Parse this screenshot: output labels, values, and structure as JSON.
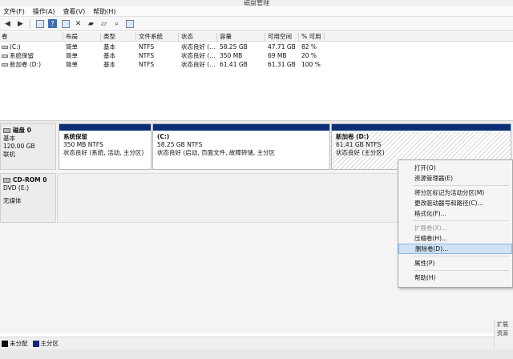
{
  "window": {
    "title": "磁盘管理"
  },
  "menu": [
    "文件(F)",
    "操作(A)",
    "查看(V)",
    "帮助(H)"
  ],
  "volume_table": {
    "headers": [
      "卷",
      "布局",
      "类型",
      "文件系统",
      "状态",
      "容量",
      "可用空间",
      "% 可用"
    ],
    "rows": [
      {
        "volume": "(C:)",
        "layout": "简单",
        "type": "基本",
        "fs": "NTFS",
        "status": "状态良好 (...",
        "capacity": "58.25 GB",
        "free": "47.71 GB",
        "pct": "82 %"
      },
      {
        "volume": "系统保留",
        "layout": "简单",
        "type": "基本",
        "fs": "NTFS",
        "status": "状态良好 (...",
        "capacity": "350 MB",
        "free": "69 MB",
        "pct": "20 %"
      },
      {
        "volume": "新加卷 (D:)",
        "layout": "简单",
        "type": "基本",
        "fs": "NTFS",
        "status": "状态良好 (...",
        "capacity": "61.41 GB",
        "free": "61.31 GB",
        "pct": "100 %"
      }
    ]
  },
  "disks": {
    "disk0": {
      "name": "磁盘 0",
      "type": "基本",
      "size": "120.00 GB",
      "state": "联机",
      "partitions": [
        {
          "name": "系统保留",
          "size": "350 MB NTFS",
          "status": "状态良好 (系统, 活动, 主分区)"
        },
        {
          "name": "(C:)",
          "size": "58.25 GB NTFS",
          "status": "状态良好 (启动, 页面文件, 故障转储, 主分区"
        },
        {
          "name": "新加卷  (D:)",
          "size": "61.41 GB NTFS",
          "status": "状态良好 (主分区)"
        }
      ]
    },
    "cdrom0": {
      "name": "CD-ROM 0",
      "drive": "DVD (E:)",
      "media": "无媒体"
    }
  },
  "context_menu": {
    "items": [
      "打开(O)",
      "资源管理器(E)",
      "将分区标记为活动分区(M)",
      "更改驱动器号和路径(C)...",
      "格式化(F)...",
      "扩展卷(X)...",
      "压缩卷(H)...",
      "删除卷(D)...",
      "属性(P)",
      "帮助(H)"
    ]
  },
  "legend": {
    "unallocated": "未分配",
    "primary": "主分区",
    "unallocated_color": "#111111",
    "primary_color": "#1a237e"
  },
  "side_peek": {
    "line1": "扩展",
    "line2": "资源"
  }
}
